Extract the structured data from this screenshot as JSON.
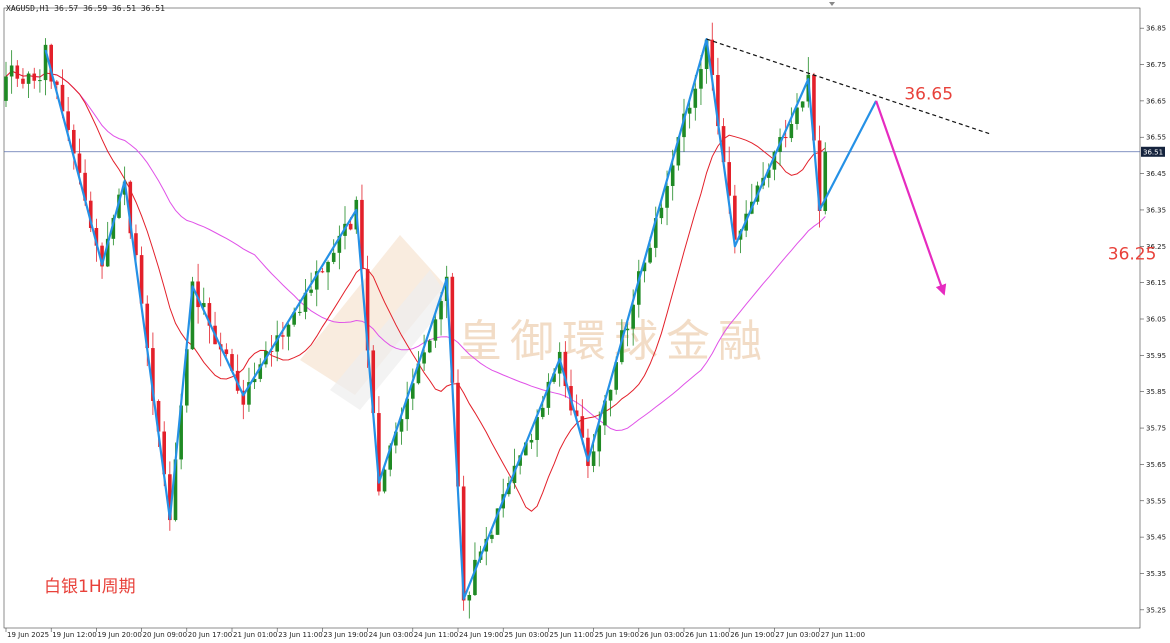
{
  "chart_data": {
    "type": "candlestick",
    "symbol_info": "XAGUSD,H1  36.57 36.59 36.51 36.51",
    "current_price": 36.51,
    "period_label": "白银1H周期",
    "watermark": "皇御環球金融",
    "ylim": [
      35.2,
      36.9
    ],
    "y_ticks": [
      "36.85",
      "36.75",
      "36.65",
      "36.55",
      "36.45",
      "36.35",
      "36.25",
      "36.15",
      "36.05",
      "35.95",
      "35.85",
      "35.75",
      "35.65",
      "35.55",
      "35.45",
      "35.35",
      "35.25"
    ],
    "x_ticks": [
      {
        "label": "19 Jun 2025",
        "i": 0
      },
      {
        "label": "19 Jun 12:00",
        "i": 8
      },
      {
        "label": "19 Jun 20:00",
        "i": 16
      },
      {
        "label": "20 Jun 09:00",
        "i": 24
      },
      {
        "label": "20 Jun 17:00",
        "i": 32
      },
      {
        "label": "21 Jun 01:00",
        "i": 40
      },
      {
        "label": "23 Jun 11:00",
        "i": 48
      },
      {
        "label": "23 Jun 19:00",
        "i": 56
      },
      {
        "label": "24 Jun 03:00",
        "i": 64
      },
      {
        "label": "24 Jun 11:00",
        "i": 72
      },
      {
        "label": "24 Jun 19:00",
        "i": 80
      },
      {
        "label": "25 Jun 03:00",
        "i": 88
      },
      {
        "label": "25 Jun 11:00",
        "i": 96
      },
      {
        "label": "25 Jun 19:00",
        "i": 104
      },
      {
        "label": "26 Jun 03:00",
        "i": 112
      },
      {
        "label": "26 Jun 11:00",
        "i": 120
      },
      {
        "label": "26 Jun 19:00",
        "i": 128
      },
      {
        "label": "27 Jun 03:00",
        "i": 136
      },
      {
        "label": "27 Jun 11:00",
        "i": 144
      }
    ],
    "zigzag": [
      {
        "i": 7,
        "price": 36.79
      },
      {
        "i": 17,
        "price": 36.2
      },
      {
        "i": 21,
        "price": 36.43
      },
      {
        "i": 29,
        "price": 35.5
      },
      {
        "i": 33,
        "price": 36.14
      },
      {
        "i": 42,
        "price": 35.84
      },
      {
        "i": 62,
        "price": 36.35
      },
      {
        "i": 66,
        "price": 35.6
      },
      {
        "i": 78,
        "price": 36.16
      },
      {
        "i": 81,
        "price": 35.28
      },
      {
        "i": 98,
        "price": 35.94
      },
      {
        "i": 103,
        "price": 35.66
      },
      {
        "i": 124,
        "price": 36.82
      },
      {
        "i": 129,
        "price": 36.25
      },
      {
        "i": 142,
        "price": 36.71
      },
      {
        "i": 144,
        "price": 36.35
      },
      {
        "i": 154,
        "price": 36.65
      }
    ],
    "projection": {
      "from": {
        "i": 154,
        "price": 36.65
      },
      "to": {
        "i": 166,
        "price": 36.12
      }
    },
    "trendline": {
      "from": {
        "i": 124,
        "price": 36.82
      },
      "to": {
        "i": 174,
        "price": 36.56
      }
    },
    "annotations": [
      {
        "text": "36.65",
        "i": 159,
        "price": 36.67
      },
      {
        "text": "36.25",
        "i": 195,
        "price": 36.23
      }
    ],
    "colors": {
      "up": "#1f8a24",
      "down": "#e3202a",
      "ma_fast": "#e3202a",
      "ma_slow": "#e052e8",
      "zigzag": "#2591e6",
      "projection": "#e62bc0",
      "hline": "#5a6fae",
      "price_tag": "#15233d"
    }
  }
}
